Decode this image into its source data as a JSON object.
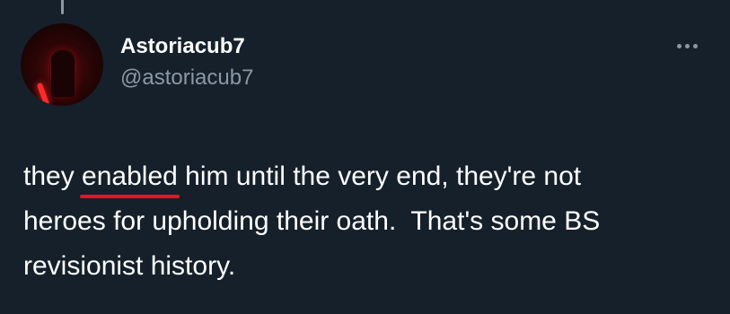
{
  "tweet": {
    "author": {
      "display_name": "Astoriacub7",
      "handle": "@astoriacub7",
      "avatar_icon": "profile-avatar-dark-figure"
    },
    "more_icon": "more-horizontal-icon",
    "text": {
      "lines": [
        {
          "before": "they ",
          "highlight": "enabled",
          "after": " him until the very end, they're not"
        },
        {
          "before": "heroes for upholding their oath.  That's some BS",
          "highlight": "",
          "after": ""
        },
        {
          "before": "revisionist history.",
          "highlight": "",
          "after": ""
        }
      ]
    }
  },
  "colors": {
    "background": "#15202b",
    "primary_text": "#ffffff",
    "secondary_text": "#8b98a5",
    "underline": "#e8141c"
  }
}
